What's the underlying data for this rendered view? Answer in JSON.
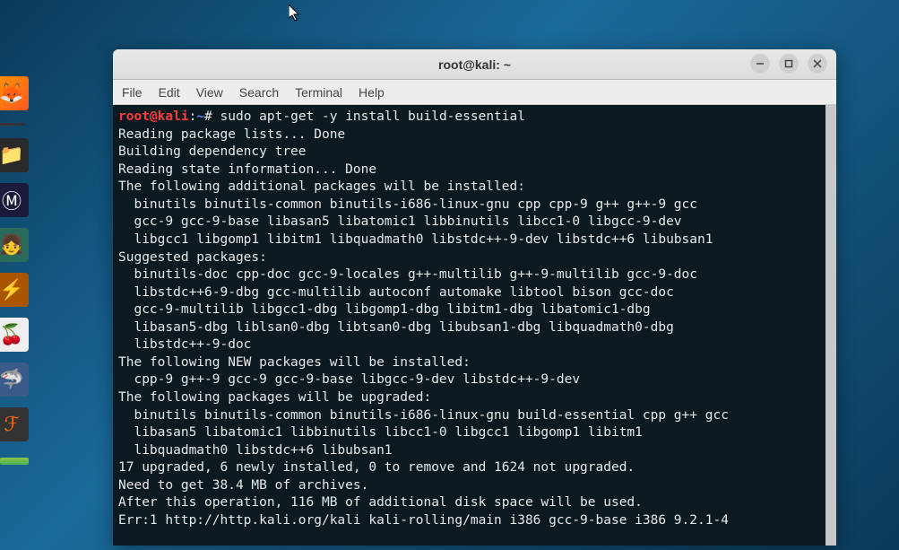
{
  "window": {
    "title": "root@kali: ~"
  },
  "menubar": {
    "file": "File",
    "edit": "Edit",
    "view": "View",
    "search": "Search",
    "terminal": "Terminal",
    "help": "Help"
  },
  "prompt": {
    "user": "root",
    "at": "@",
    "host": "kali",
    "colon": ":",
    "path": "~",
    "hash": "#",
    "command": "sudo apt-get -y install build-essential"
  },
  "output": {
    "l01": "Reading package lists... Done",
    "l02": "Building dependency tree",
    "l03": "Reading state information... Done",
    "l04": "The following additional packages will be installed:",
    "l05": "  binutils binutils-common binutils-i686-linux-gnu cpp cpp-9 g++ g++-9 gcc",
    "l06": "  gcc-9 gcc-9-base libasan5 libatomic1 libbinutils libcc1-0 libgcc-9-dev",
    "l07": "  libgcc1 libgomp1 libitm1 libquadmath0 libstdc++-9-dev libstdc++6 libubsan1",
    "l08": "Suggested packages:",
    "l09": "  binutils-doc cpp-doc gcc-9-locales g++-multilib g++-9-multilib gcc-9-doc",
    "l10": "  libstdc++6-9-dbg gcc-multilib autoconf automake libtool bison gcc-doc",
    "l11": "  gcc-9-multilib libgcc1-dbg libgomp1-dbg libitm1-dbg libatomic1-dbg",
    "l12": "  libasan5-dbg liblsan0-dbg libtsan0-dbg libubsan1-dbg libquadmath0-dbg",
    "l13": "  libstdc++-9-doc",
    "l14": "The following NEW packages will be installed:",
    "l15": "  cpp-9 g++-9 gcc-9 gcc-9-base libgcc-9-dev libstdc++-9-dev",
    "l16": "The following packages will be upgraded:",
    "l17": "  binutils binutils-common binutils-i686-linux-gnu build-essential cpp g++ gcc",
    "l18": "  libasan5 libatomic1 libbinutils libcc1-0 libgcc1 libgomp1 libitm1",
    "l19": "  libquadmath0 libstdc++6 libubsan1",
    "l20": "17 upgraded, 6 newly installed, 0 to remove and 1624 not upgraded.",
    "l21": "Need to get 38.4 MB of archives.",
    "l22": "After this operation, 116 MB of additional disk space will be used.",
    "l23": "Err:1 http://http.kali.org/kali kali-rolling/main i386 gcc-9-base i386 9.2.1-4"
  }
}
